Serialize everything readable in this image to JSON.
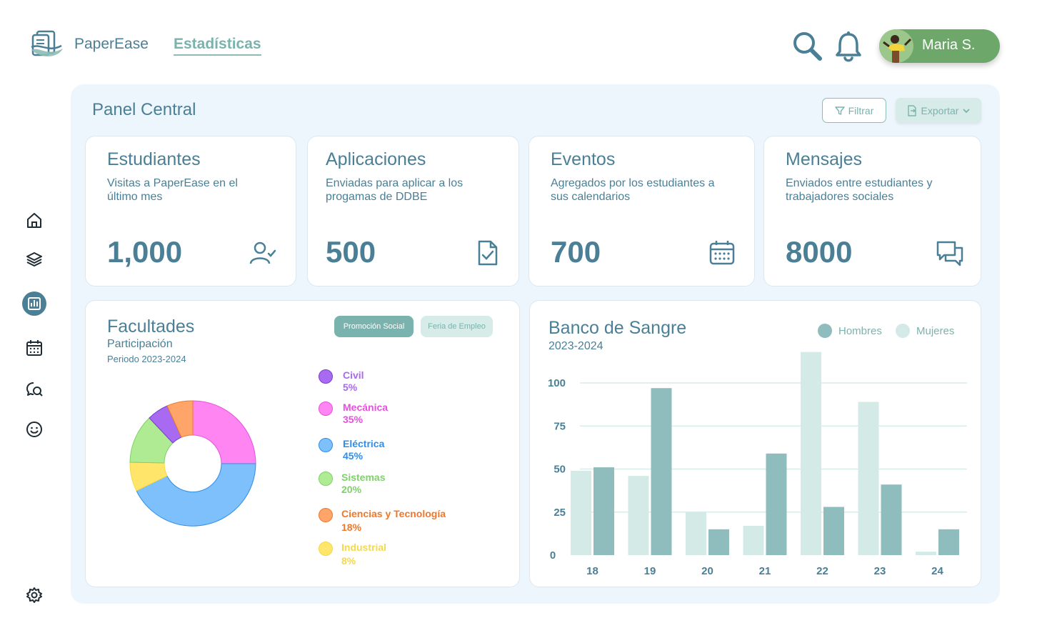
{
  "header": {
    "brand": "PaperEase",
    "active_tab": "Estadísticas",
    "user_name": "Maria S."
  },
  "sidebar": {
    "items": [
      {
        "icon": "home-icon"
      },
      {
        "icon": "layers-icon"
      },
      {
        "icon": "chart-icon",
        "active": true
      },
      {
        "icon": "calendar-icon"
      },
      {
        "icon": "chat-search-icon"
      },
      {
        "icon": "smiley-icon"
      },
      {
        "icon": "gear-icon"
      }
    ]
  },
  "panel": {
    "title": "Panel Central",
    "filter_label": "Filtrar",
    "export_label": "Exportar"
  },
  "stats": [
    {
      "title": "Estudiantes",
      "desc": "Visitas a PaperEase en el último mes",
      "value": "1,000",
      "icon": "user-check-icon"
    },
    {
      "title": "Aplicaciones",
      "desc": "Enviadas para aplicar a los progamas de DDBE",
      "value": "500",
      "icon": "file-check-icon"
    },
    {
      "title": "Eventos",
      "desc": "Agregados por los estudiantes a sus calendarios",
      "value": "700",
      "icon": "calendar-icon"
    },
    {
      "title": "Mensajes",
      "desc": "Enviados entre estudiantes y trabajadores sociales",
      "value": "8000",
      "icon": "messages-icon"
    }
  ],
  "facultades": {
    "title": "Facultades",
    "subtitle": "Participación",
    "period": "Periodo 2023-2024",
    "tab_active": "Promoción Social",
    "tab_inactive": "Feria de Empleo",
    "legend": [
      {
        "name": "Civil",
        "pct": "5%",
        "color": "#a86af0",
        "fill": "#a86af0"
      },
      {
        "name": "Mecánica",
        "pct": "35%",
        "color": "#e84fe0",
        "fill": "#ff85f3"
      },
      {
        "name": "Eléctrica",
        "pct": "45%",
        "color": "#2f8ee8",
        "fill": "#7ec0fb"
      },
      {
        "name": "Sistemas",
        "pct": "20%",
        "color": "#7fd16a",
        "fill": "#aeeb93"
      },
      {
        "name": "Ciencias y Tecnología",
        "pct": "18%",
        "color": "#f0782a",
        "fill": "#ffa56a"
      },
      {
        "name": "Industrial",
        "pct": "8%",
        "color": "#f5d94a",
        "fill": "#ffe66a"
      }
    ]
  },
  "chart_data": {
    "type": "bar",
    "title": "Banco de Sangre",
    "subtitle": "2023-2024",
    "categories": [
      "18",
      "19",
      "20",
      "21",
      "22",
      "23",
      "24"
    ],
    "series": [
      {
        "name": "Mujeres",
        "color": "#d3eae7",
        "values": [
          49,
          46,
          25,
          17,
          118,
          89,
          2
        ]
      },
      {
        "name": "Hombres",
        "color": "#8fbdbd",
        "values": [
          51,
          97,
          15,
          59,
          28,
          41,
          15
        ]
      }
    ],
    "yticks": [
      0,
      25,
      50,
      75,
      100
    ],
    "ylim": [
      0,
      120
    ],
    "grid": true,
    "legend_position": "top-right"
  }
}
